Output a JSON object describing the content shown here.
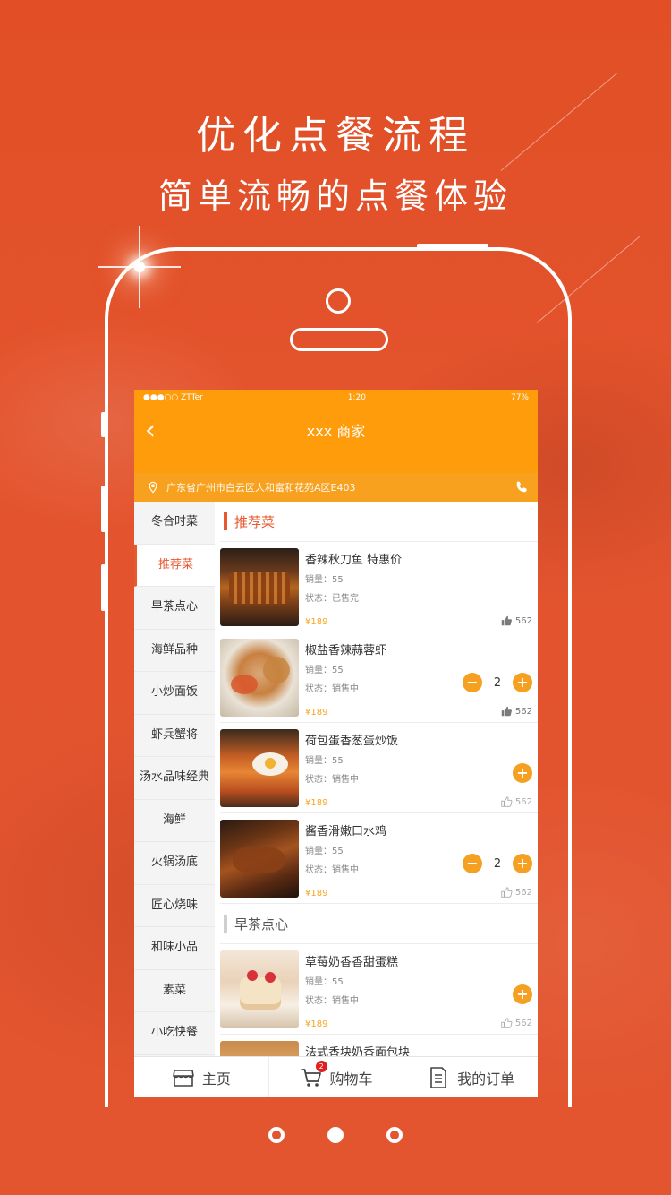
{
  "promo": {
    "headline": "优化点餐流程",
    "subheadline": "简单流畅的点餐体验"
  },
  "status_bar": {
    "carrier": "●●●○○ ZTTer",
    "time": "1:20",
    "battery": "77%"
  },
  "nav": {
    "back_icon": "‹",
    "title": "xxx 商家"
  },
  "address": {
    "text": "广东省广州市白云区人和富和花苑A区E403"
  },
  "categories": [
    {
      "label": "冬合时菜"
    },
    {
      "label": "推荐菜"
    },
    {
      "label": "早茶点心"
    },
    {
      "label": "海鲜品种"
    },
    {
      "label": "小炒面饭"
    },
    {
      "label": "虾兵蟹将"
    },
    {
      "label": "汤水品味经典"
    },
    {
      "label": "海鲜"
    },
    {
      "label": "火锅汤底"
    },
    {
      "label": "匠心烧味"
    },
    {
      "label": "和味小品"
    },
    {
      "label": "素菜"
    },
    {
      "label": "小吃快餐"
    }
  ],
  "sections": {
    "recommended": "推荐菜",
    "dim_sum": "早茶点心"
  },
  "items": [
    {
      "name": "香辣秋刀鱼 特惠价",
      "sales": "销量：55",
      "status": "状态：已售完",
      "price": "¥189",
      "likes": "562",
      "qty": ""
    },
    {
      "name": "椒盐香辣蒜蓉虾",
      "sales": "销量：55",
      "status": "状态：销售中",
      "price": "¥189",
      "likes": "562",
      "qty": "2"
    },
    {
      "name": "荷包蛋香葱蛋炒饭",
      "sales": "销量：55",
      "status": "状态：销售中",
      "price": "¥189",
      "likes": "562",
      "qty": ""
    },
    {
      "name": "酱香滑嫩口水鸡",
      "sales": "销量：55",
      "status": "状态：销售中",
      "price": "¥189",
      "likes": "562",
      "qty": "2"
    },
    {
      "name": "草莓奶香香甜蛋糕",
      "sales": "销量：55",
      "status": "状态：销售中",
      "price": "¥189",
      "likes": "562",
      "qty": ""
    },
    {
      "name": "法式香块奶香面包块"
    }
  ],
  "tabs": {
    "home": "主页",
    "cart": "购物车",
    "cart_badge": "2",
    "orders": "我的订单"
  },
  "pager": {
    "current_page": 2,
    "total_pages": 3
  },
  "colors": {
    "background": "#e5532c",
    "header": "#ff9c0c",
    "accent": "#e7582e",
    "stepper": "#f5a020"
  }
}
